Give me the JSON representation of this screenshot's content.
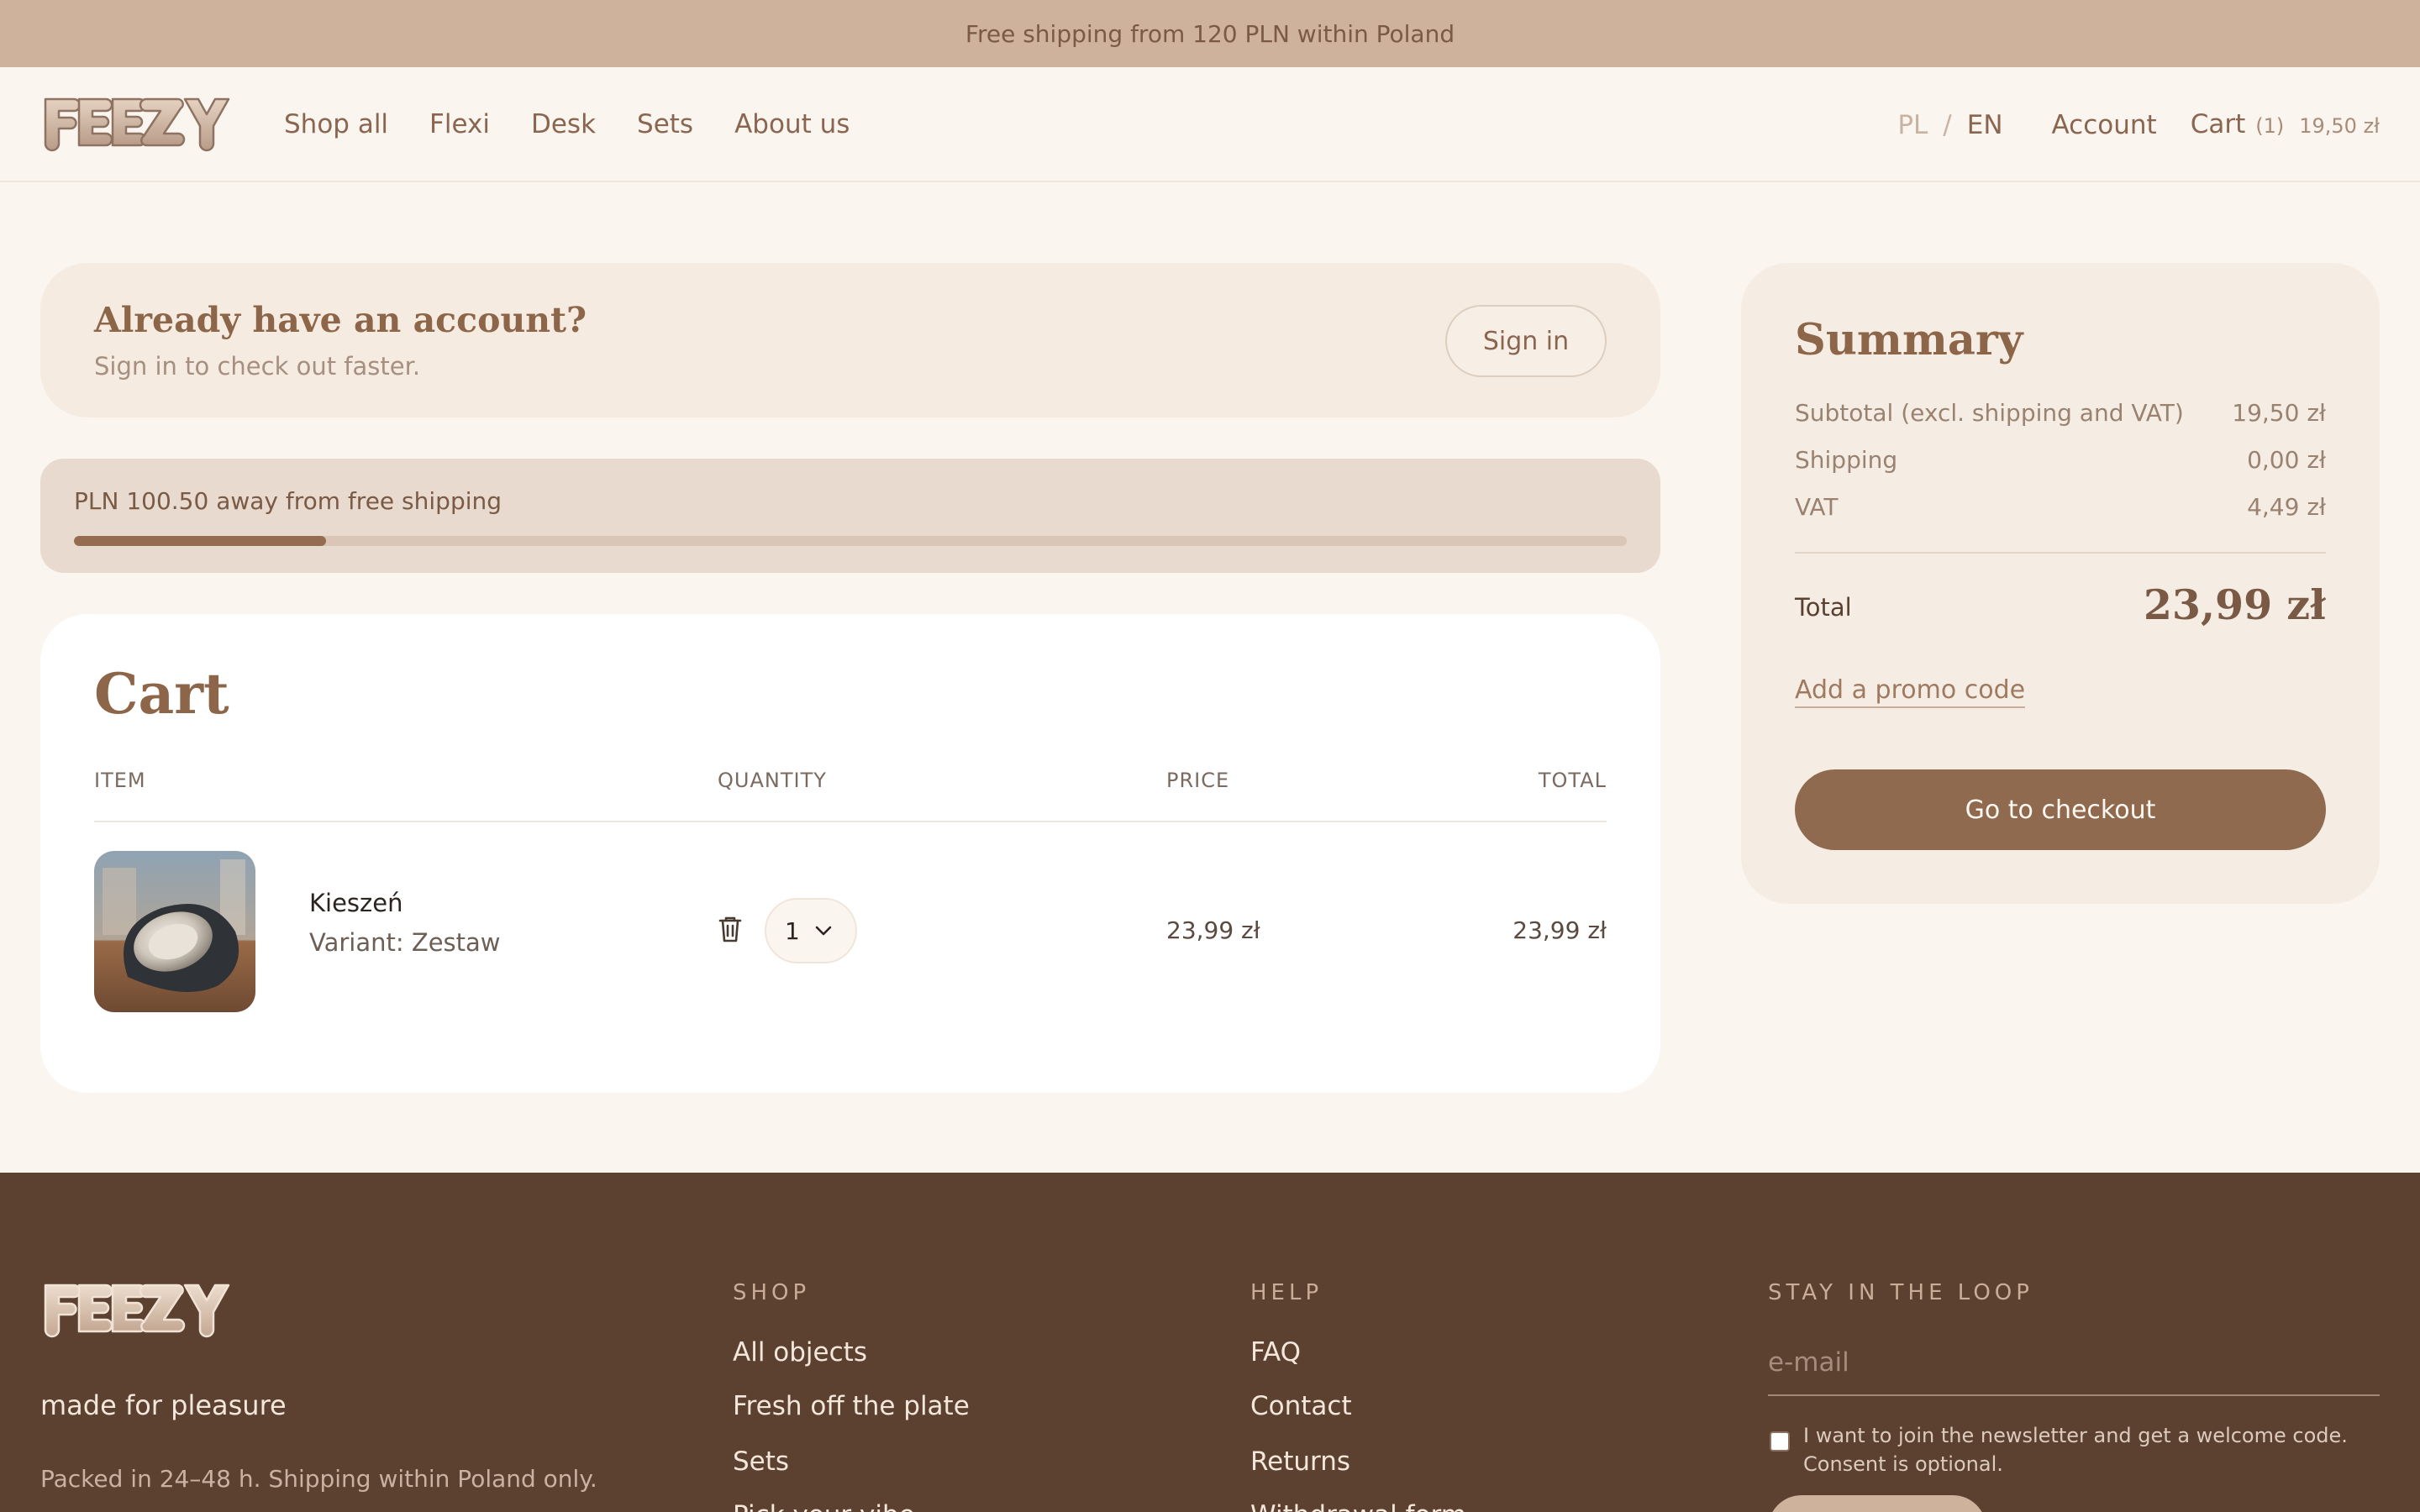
{
  "announcement": "Free shipping from 120 PLN within Poland",
  "brand": {
    "logo_text": "FEEZY"
  },
  "nav": {
    "items": [
      "Shop all",
      "Flexi",
      "Desk",
      "Sets",
      "About us"
    ]
  },
  "header_right": {
    "lang_pl": "PL",
    "lang_sep": "/",
    "lang_en": "EN",
    "account": "Account",
    "cart_label": "Cart",
    "cart_count": "(1)",
    "cart_total": "19,50 zł"
  },
  "account_prompt": {
    "title": "Already have an account?",
    "subtitle": "Sign in to check out faster.",
    "button": "Sign in"
  },
  "shipping_progress": {
    "text": "PLN 100.50 away from free shipping",
    "progress_fraction": 0.1625
  },
  "cart": {
    "title": "Cart",
    "columns": [
      "ITEM",
      "QUANTITY",
      "PRICE",
      "TOTAL"
    ],
    "items": [
      {
        "name": "Kieszeń",
        "variant": "Variant: Zestaw",
        "quantity": "1",
        "price": "23,99 zł",
        "total": "23,99 zł"
      }
    ]
  },
  "summary": {
    "title": "Summary",
    "rows": [
      {
        "label": "Subtotal (excl. shipping and VAT)",
        "value": "19,50 zł"
      },
      {
        "label": "Shipping",
        "value": "0,00 zł"
      },
      {
        "label": "VAT",
        "value": "4,49 zł"
      }
    ],
    "total_label": "Total",
    "total_value": "23,99 zł",
    "promo_link": "Add a promo code",
    "checkout_button": "Go to checkout"
  },
  "footer": {
    "tagline": "made for pleasure",
    "packed": "Packed in 24–48 h. Shipping within Poland only.",
    "shop": {
      "heading": "SHOP",
      "links": [
        "All objects",
        "Fresh off the plate",
        "Sets",
        "Pick your vibe"
      ]
    },
    "help": {
      "heading": "HELP",
      "links": [
        "FAQ",
        "Contact",
        "Returns",
        "Withdrawal form"
      ]
    },
    "newsletter": {
      "heading": "STAY IN THE LOOP",
      "email_placeholder": "e-mail",
      "consent": "I want to join the newsletter and get a welcome code. Consent is optional."
    }
  },
  "colors": {
    "announcement_bg": "#cfb29c",
    "page_bg": "#faf5ef",
    "accent": "#8f6a4f",
    "footer_bg": "#5c4030"
  }
}
